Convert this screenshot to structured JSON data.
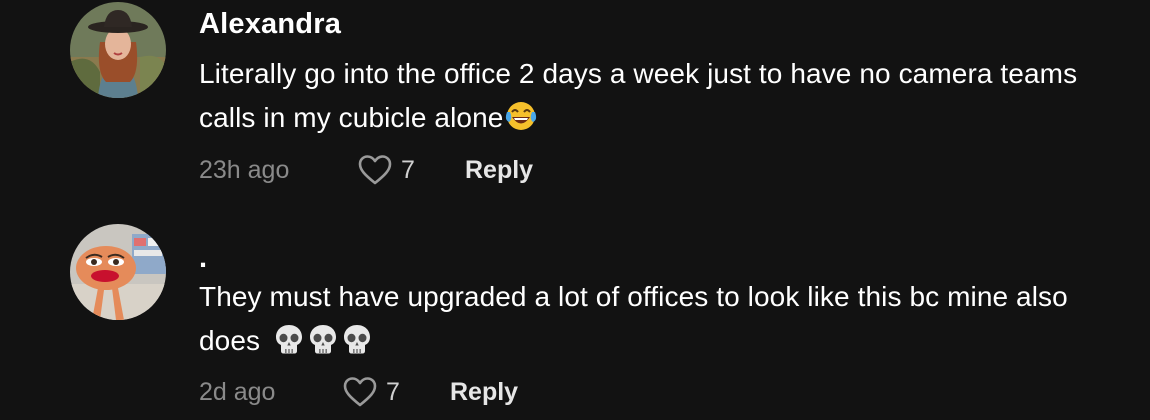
{
  "comments": [
    {
      "username": "Alexandra",
      "text": "Literally go into the office 2 days a week just to have no camera teams calls in my cubicle alone",
      "emojis": [
        "face-with-tears-of-joy-icon"
      ],
      "time": "23h ago",
      "likes": "7",
      "reply_label": "Reply"
    },
    {
      "username": ".",
      "text": "They must have upgraded a lot of offices to look like this bc mine also does",
      "emojis": [
        "skull-icon",
        "skull-icon",
        "skull-icon"
      ],
      "time": "2d ago",
      "likes": "7",
      "reply_label": "Reply"
    }
  ]
}
